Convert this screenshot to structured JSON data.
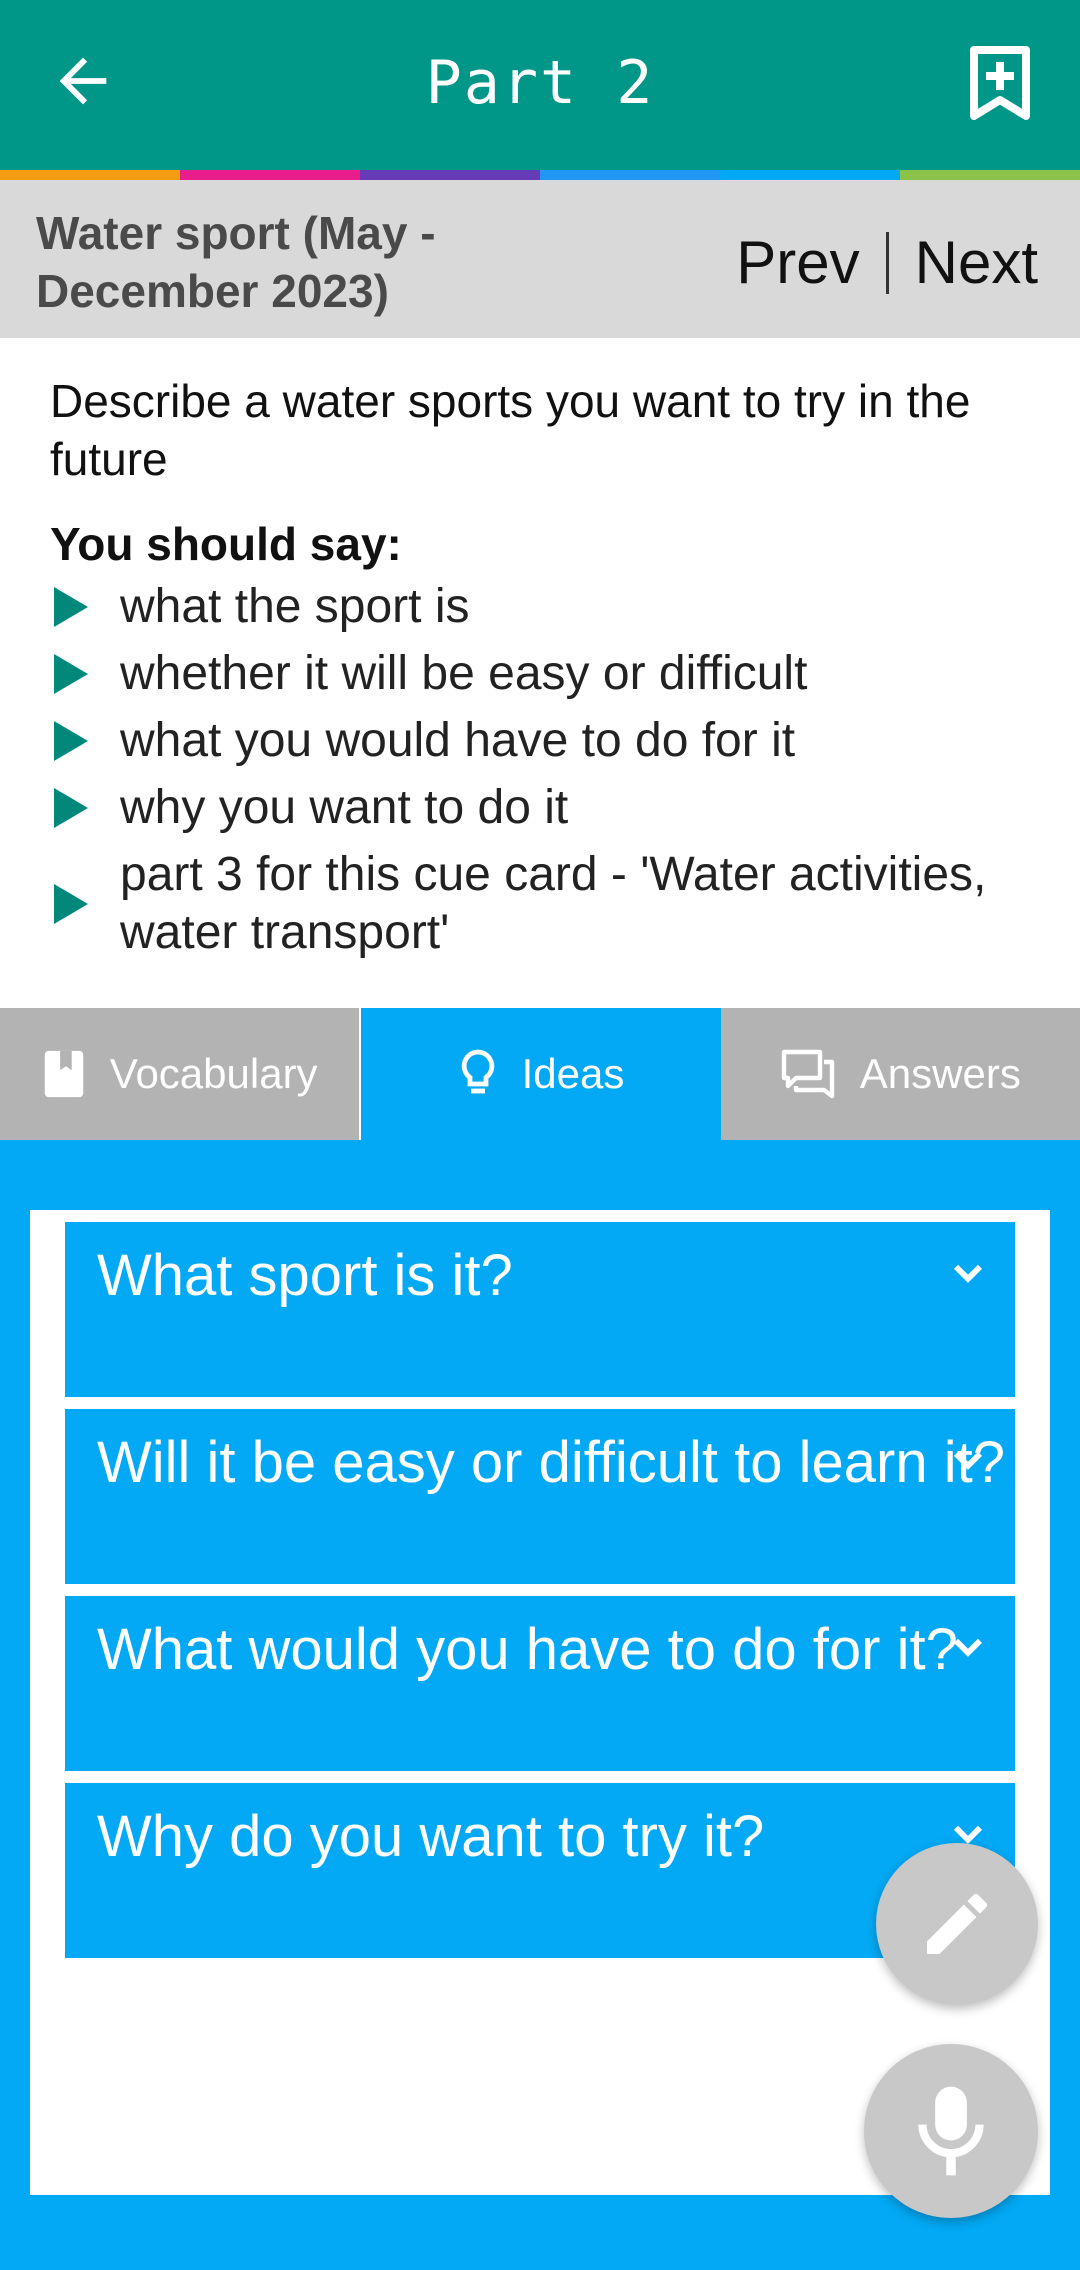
{
  "app_bar": {
    "title": "Part 2",
    "back_icon": "arrow-back-icon",
    "bookmark_icon": "bookmark-add-icon",
    "background": "#009688"
  },
  "accent_strip": [
    "#f39c12",
    "#e91e8c",
    "#673ab7",
    "#2196f3",
    "#03a9f4",
    "#8bc34a"
  ],
  "topic": {
    "title": "Water sport (May - December 2023)",
    "prev_label": "Prev",
    "next_label": "Next"
  },
  "cue_card": {
    "prompt": "Describe a water sports you want to try in the future",
    "should_say": "You should say:",
    "points": [
      "what the sport is",
      "whether it will be easy or difficult",
      "what you would have to do for it",
      "why you want to do it",
      "part 3 for this cue card - 'Water activities, water transport'"
    ]
  },
  "tabs": [
    {
      "label": "Vocabulary",
      "icon": "book-icon",
      "active": false
    },
    {
      "label": "Ideas",
      "icon": "lightbulb-icon",
      "active": true
    },
    {
      "label": "Answers",
      "icon": "chat-bubbles-icon",
      "active": false
    }
  ],
  "ideas": {
    "questions": [
      "What sport is it?",
      "Will it be easy or difficult to learn it?",
      "What would you have to do for it?",
      "Why do you want to try it?"
    ]
  },
  "fabs": {
    "edit_icon": "pencil-icon",
    "mic_icon": "microphone-icon"
  },
  "colors": {
    "primary": "#009688",
    "accent_blue": "#03a9f4",
    "bullet": "#00897b",
    "inactive_tab": "#b3b3b3"
  }
}
